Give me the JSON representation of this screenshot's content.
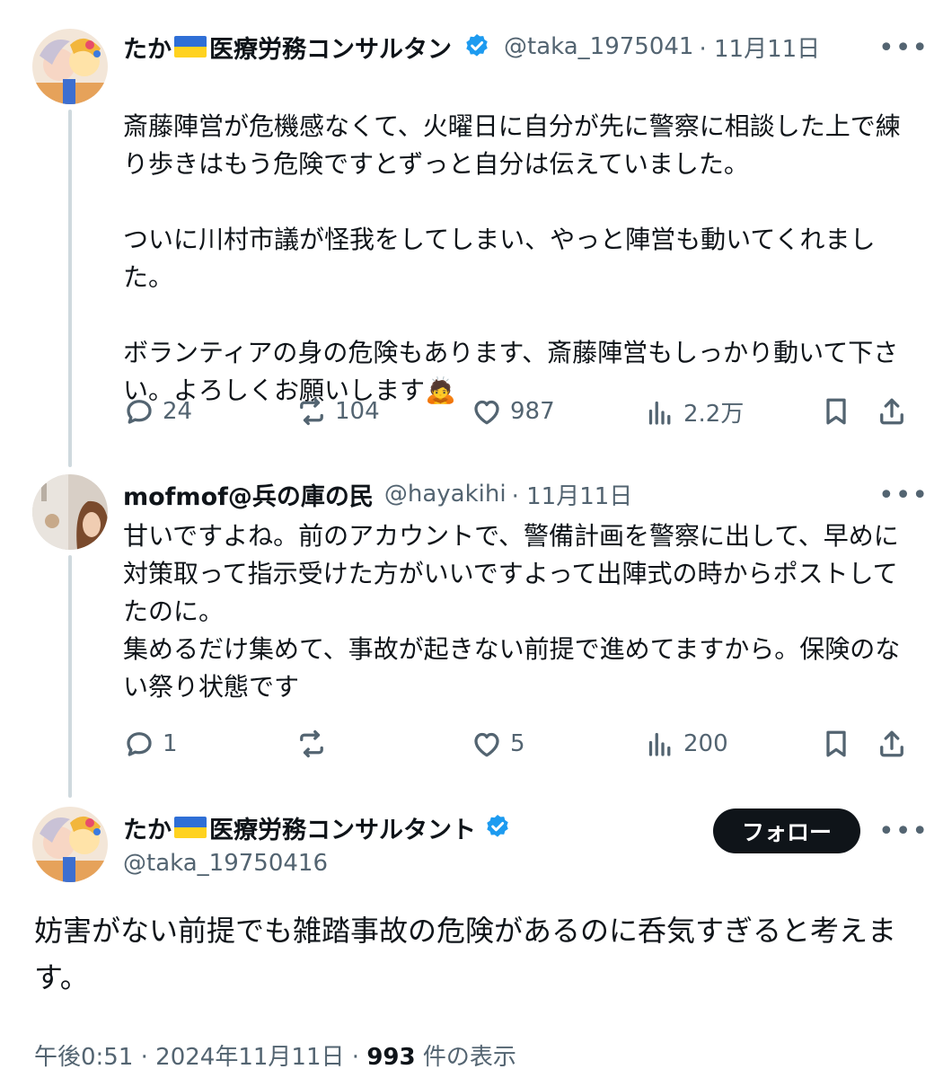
{
  "tweets": [
    {
      "name": "たか",
      "name_suffix": "医療労務コンサルタン",
      "handle": "@taka_1975041",
      "date": "· 11月11日",
      "text": "斎藤陣営が危機感なくて、火曜日に自分が先に警察に相談した上で練り歩きはもう危険ですとずっと自分は伝えていました。\n\nついに川村市議が怪我をしてしまい、やっと陣営も動いてくれました。\n\nボランティアの身の危険もあります、斎藤陣営もしっかり動いて下さい。よろしくお願いします",
      "emoji": "🙇",
      "replies": "24",
      "reposts": "104",
      "likes": "987",
      "views": "2.2万"
    },
    {
      "name": "mofmof@兵の庫の民",
      "handle": "@hayakihi",
      "date": "· 11月11日",
      "text": "甘いですよね。前のアカウントで、警備計画を警察に出して、早めに対策取って指示受けた方がいいですよって出陣式の時からポストしてたのに。\n集めるだけ集めて、事故が起きない前提で進めてますから。保険のない祭り状態です",
      "replies": "1",
      "reposts": "",
      "likes": "5",
      "views": "200"
    }
  ],
  "main_tweet": {
    "name": "たか",
    "name_suffix": "医療労務コンサルタント",
    "handle": "@taka_19750416",
    "follow_label": "フォロー",
    "text": "妨害がない前提でも雑踏事故の危険があるのに呑気すぎると考えます。",
    "time": "午後0:51 · 2024年11月11日 · ",
    "view_count": "993",
    "view_label": " 件の表示"
  },
  "colors": {
    "text": "#0f1419",
    "secondary": "#536471",
    "verified": "#1d9bf0",
    "thread_line": "#cfd9de",
    "flag_blue": "#2f6fd6",
    "flag_yellow": "#ffd21f"
  },
  "icons": [
    "verified-badge-icon",
    "ukraine-flag-icon",
    "reply-icon",
    "repost-icon",
    "like-icon",
    "views-icon",
    "bookmark-icon",
    "share-icon",
    "more-icon"
  ]
}
